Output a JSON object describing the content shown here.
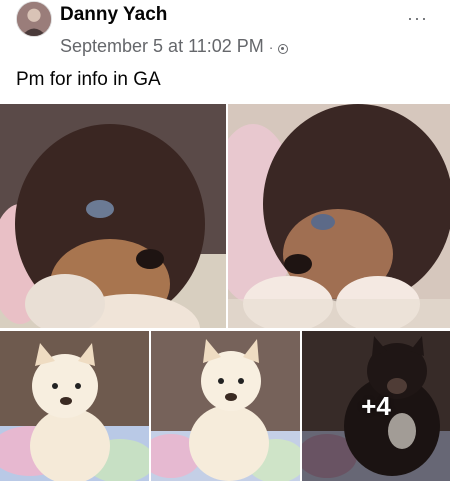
{
  "post": {
    "author": "Danny Yach",
    "timestamp": "September 5 at 11:02 PM",
    "separator": "·",
    "privacy_icon": "globe-icon",
    "more_icon": "more-options-icon",
    "more_label": "···",
    "text": "Pm for info in GA"
  },
  "photos": {
    "more_count": "+4"
  },
  "colors": {
    "text_primary": "#050505",
    "text_secondary": "#65676b"
  }
}
